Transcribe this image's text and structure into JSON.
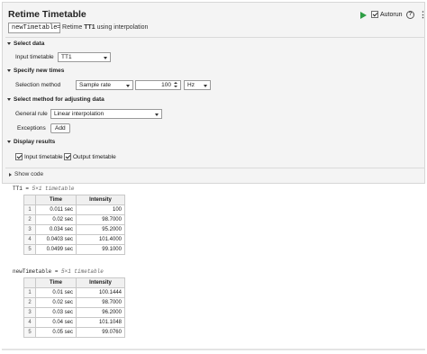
{
  "header": {
    "title": "Retime Timetable",
    "output_var": "newTimetable",
    "equals": "=",
    "subtitle_prefix": "Retime",
    "subtitle_var": "TT1",
    "subtitle_suffix": "using interpolation",
    "autorun_label": "Autorun",
    "autorun_checked": true,
    "help_glyph": "?",
    "more_glyph": "⋮",
    "run_icon": "run-icon",
    "run_icon_color": "#2e9e44"
  },
  "select_data": {
    "heading": "Select data",
    "input_label": "Input timetable",
    "input_value": "TT1"
  },
  "new_times": {
    "heading": "Specify new times",
    "method_label": "Selection method",
    "method_value": "Sample rate",
    "rate_value": "100",
    "unit_value": "Hz"
  },
  "adjust": {
    "heading": "Select method for adjusting data",
    "rule_label": "General rule",
    "rule_value": "Linear interpolation",
    "exceptions_label": "Exceptions",
    "add_label": "Add"
  },
  "display": {
    "heading": "Display results",
    "input_tt_label": "Input timetable",
    "output_tt_label": "Output timetable"
  },
  "show_code_label": "Show code",
  "output1": {
    "var": "TT1",
    "eq": " = ",
    "size": "5×1 timetable",
    "columns": [
      "Time",
      "Intensity"
    ],
    "rows": [
      {
        "idx": "1",
        "time": "0.011 sec",
        "value": "100"
      },
      {
        "idx": "2",
        "time": "0.02 sec",
        "value": "98.7000"
      },
      {
        "idx": "3",
        "time": "0.034 sec",
        "value": "95.2000"
      },
      {
        "idx": "4",
        "time": "0.0403 sec",
        "value": "101.4000"
      },
      {
        "idx": "5",
        "time": "0.0499 sec",
        "value": "99.1000"
      }
    ]
  },
  "output2": {
    "var": "newTimetable",
    "eq": " = ",
    "size": "5×1 timetable",
    "columns": [
      "Time",
      "Intensity"
    ],
    "rows": [
      {
        "idx": "1",
        "time": "0.01 sec",
        "value": "100.1444"
      },
      {
        "idx": "2",
        "time": "0.02 sec",
        "value": "98.7000"
      },
      {
        "idx": "3",
        "time": "0.03 sec",
        "value": "96.2000"
      },
      {
        "idx": "4",
        "time": "0.04 sec",
        "value": "101.1048"
      },
      {
        "idx": "5",
        "time": "0.05 sec",
        "value": "99.0760"
      }
    ]
  }
}
